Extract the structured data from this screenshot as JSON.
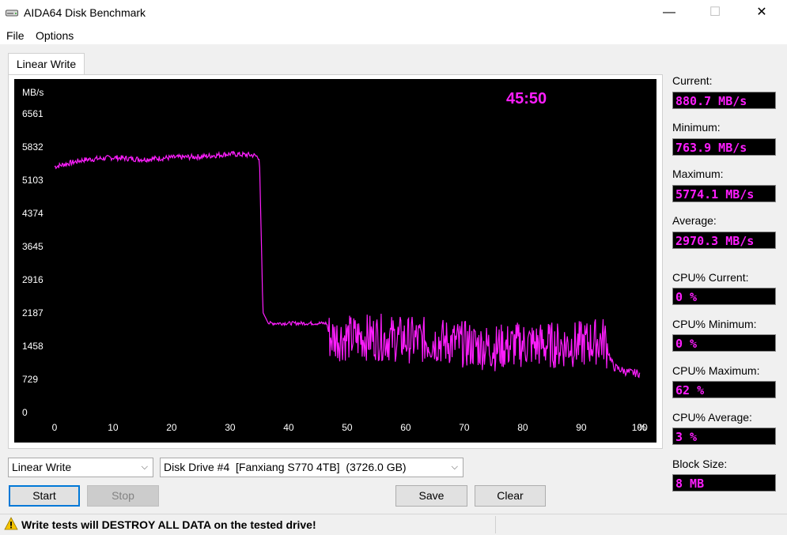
{
  "window": {
    "title": "AIDA64 Disk Benchmark",
    "minimize": "—",
    "maximize": "☐",
    "close": "✕"
  },
  "menu": {
    "file": "File",
    "options": "Options"
  },
  "tab": {
    "label": "Linear Write"
  },
  "chart_data": {
    "type": "line",
    "title": "",
    "ylabel": "MB/s",
    "xlabel": "",
    "x_unit": "%",
    "timer": "45:50",
    "y_ticks": [
      "6561",
      "5832",
      "5103",
      "4374",
      "3645",
      "2916",
      "2187",
      "1458",
      "729",
      "0"
    ],
    "x_ticks": [
      "0",
      "10",
      "20",
      "30",
      "40",
      "50",
      "60",
      "70",
      "80",
      "90",
      "100"
    ],
    "xlim": [
      0,
      100
    ],
    "ylim": [
      0,
      6561
    ],
    "series": [
      {
        "color": "#ff1eff",
        "x": [
          0,
          5,
          10,
          15,
          20,
          25,
          30,
          34,
          35,
          35.6,
          36.5,
          40,
          46.5,
          47,
          50,
          55,
          60,
          65,
          70,
          75,
          80,
          85,
          90,
          94,
          94.8,
          95.5,
          98,
          100
        ],
        "y": [
          5400,
          5550,
          5600,
          5560,
          5600,
          5620,
          5680,
          5650,
          5600,
          2200,
          1960,
          1960,
          1960,
          1650,
          1640,
          1660,
          1600,
          1580,
          1500,
          1420,
          1500,
          1480,
          1500,
          1600,
          1250,
          1000,
          880,
          860
        ]
      }
    ]
  },
  "stats": {
    "current": {
      "label": "Current:",
      "value": "880.7 MB/s"
    },
    "minimum": {
      "label": "Minimum:",
      "value": "763.9 MB/s"
    },
    "maximum": {
      "label": "Maximum:",
      "value": "5774.1 MB/s"
    },
    "average": {
      "label": "Average:",
      "value": "2970.3 MB/s"
    },
    "cpu_current": {
      "label": "CPU% Current:",
      "value": "0 %"
    },
    "cpu_minimum": {
      "label": "CPU% Minimum:",
      "value": "0 %"
    },
    "cpu_maximum": {
      "label": "CPU% Maximum:",
      "value": "62 %"
    },
    "cpu_average": {
      "label": "CPU% Average:",
      "value": "3 %"
    },
    "block_size": {
      "label": "Block Size:",
      "value": "8 MB"
    }
  },
  "controls": {
    "test_select": "Linear Write",
    "drive_select": "Disk Drive #4  [Fanxiang S770 4TB]  (3726.0 GB)",
    "start": "Start",
    "stop": "Stop",
    "save": "Save",
    "clear": "Clear"
  },
  "status": {
    "warning": "Write tests will DESTROY ALL DATA on the tested drive!"
  },
  "colors": {
    "plot_line": "#ff1eff",
    "value_text": "#ff1eff",
    "chart_bg": "#000000",
    "accent": "#0078d7"
  }
}
